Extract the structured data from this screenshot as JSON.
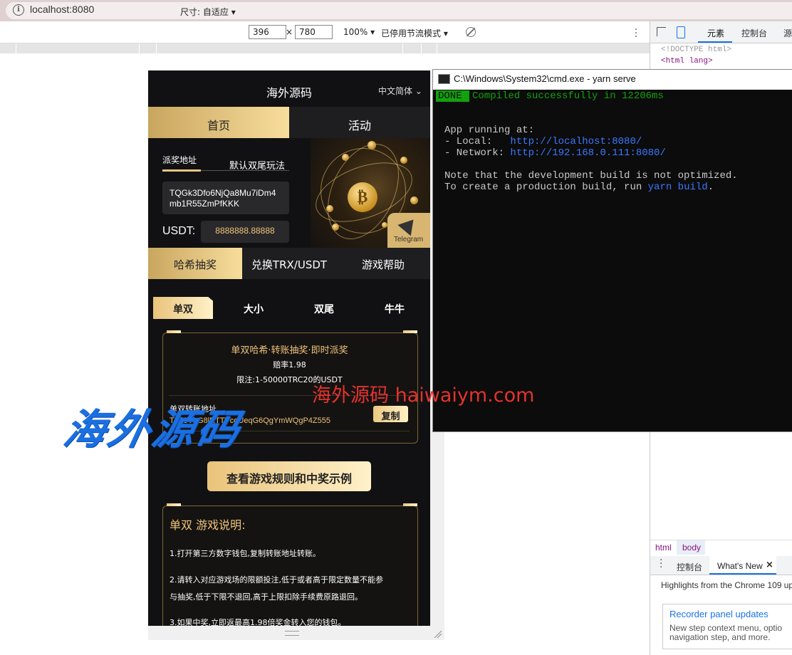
{
  "browser": {
    "url": "localhost:8080",
    "device_toolbar": {
      "size_label": "尺寸: 自适应",
      "width": "396",
      "times": "×",
      "height": "780",
      "zoom": "100%",
      "throttle": "已停用节流模式"
    }
  },
  "devtools": {
    "tab_elements": "元素",
    "tab_console": "控制台",
    "tab_sources": "源",
    "code_lines": [
      "<!DOCTYPE html>",
      "<html lang>"
    ],
    "crumb_html": "html",
    "crumb_body": "body",
    "drawer_console": "控制台",
    "drawer_whats_new": "What's New",
    "drawer_close": "×",
    "highlights": "Highlights from the Chrome 109 up",
    "news_title": "Recorder panel updates",
    "news_line1": "New step context menu, optio",
    "news_line2": "navigation step, and more."
  },
  "app": {
    "title": "海外源码",
    "language": "中文简体",
    "nav_home": "首页",
    "nav_activity": "活动",
    "tab_award_address": "派奖地址",
    "tab_default_mode": "默认双尾玩法",
    "wallet_address_line1": "TQGk3Dfo6NjQa8Mu7iDm4",
    "wallet_address_line2": "mb1R55ZmPfKKK",
    "usdt_label": "USDT:",
    "usdt_value": "8888888.88888",
    "telegram_label": "Telegram",
    "menu_hash_lottery": "哈希抽奖",
    "menu_exchange": "兑换TRX/USDT",
    "menu_help": "游戏帮助",
    "game_tabs": [
      "单双",
      "大小",
      "双尾",
      "牛牛"
    ],
    "card_title": "单双哈希·转账抽奖·即时派奖",
    "card_odds": "赔率1.98",
    "card_limit": "限注:1-50000TRC20的USDT",
    "card_address_label": "单双转账地址",
    "card_address": "TZ78VhG8lRTTVcoUeqG6QgYmWQgP4Z555",
    "copy_button": "复制",
    "rules_button": "查看游戏规则和中奖示例",
    "desc_title": "单双 游戏说明:",
    "desc_1": "1.打开第三方数字钱包,复制转账地址转账。",
    "desc_2a": "2.请转入对应游戏场的限额投注,低于或者高于限定数量不能参",
    "desc_2b": "与抽奖,低于下限不退回,高于上限扣除手续费原路退回。",
    "desc_3": "3.如果中奖,立即返最高1.98倍奖金转入您的钱包。"
  },
  "watermark": {
    "red": "海外源码 haiwaiym.com",
    "blue": "海外源码"
  },
  "terminal": {
    "title": "C:\\Windows\\System32\\cmd.exe - yarn  serve",
    "done": "DONE",
    "compiled": "Compiled successfully in 12206ms",
    "running": "App running at:",
    "local_label": "- Local:   ",
    "local_url": "http://localhost:8080/",
    "network_label": "- Network: ",
    "network_url": "http://192.168.0.111:8080/",
    "note1": "Note that the development build is not optimized.",
    "note2_prefix": "To create a production build, run ",
    "note2_cmd": "yarn build",
    "note2_suffix": "."
  },
  "colors": {
    "gold": "#d8b671",
    "app_bg": "#111113",
    "term_green": "#13a10e",
    "term_link": "#3b78ff",
    "devtools_blue": "#1a73e8"
  }
}
